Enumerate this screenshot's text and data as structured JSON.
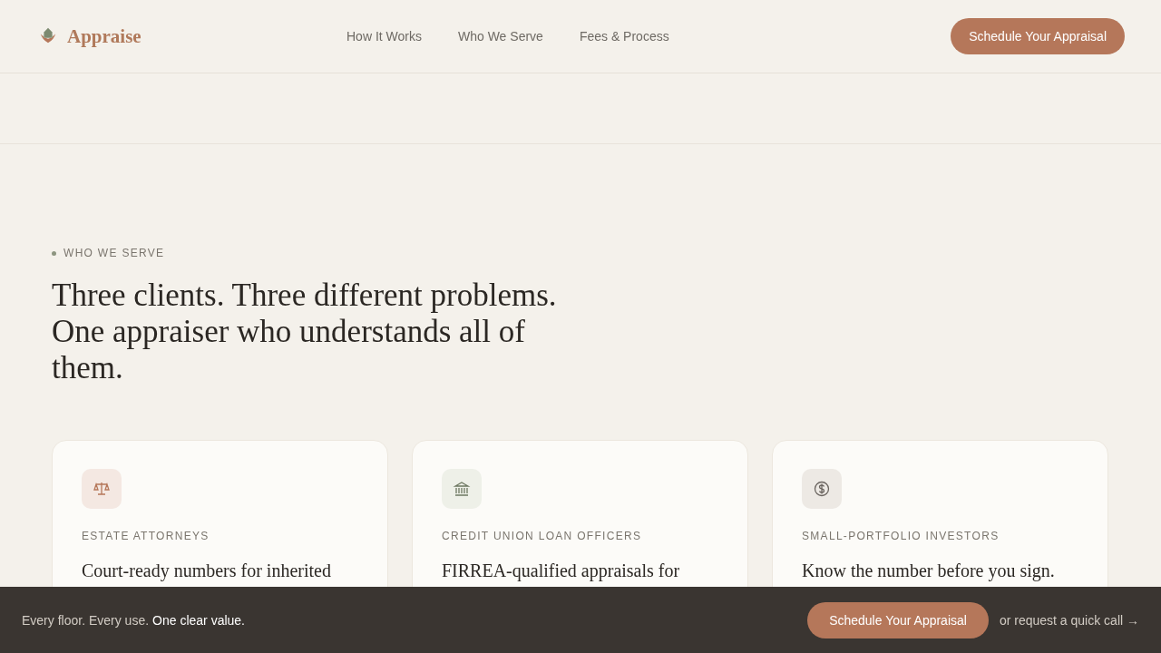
{
  "header": {
    "brand": "Appraise",
    "nav": [
      {
        "label": "How It Works"
      },
      {
        "label": "Who We Serve"
      },
      {
        "label": "Fees & Process"
      }
    ],
    "cta": "Schedule Your Appraisal"
  },
  "section": {
    "eyebrow": "WHO WE SERVE",
    "heading": "Three clients. Three different problems. One appraiser who understands all of them.",
    "cards": [
      {
        "label": "ESTATE ATTORNEYS",
        "headline": "Court-ready numbers for inherited"
      },
      {
        "label": "CREDIT UNION LOAN OFFICERS",
        "headline": "FIRREA-qualified appraisals for"
      },
      {
        "label": "SMALL-PORTFOLIO INVESTORS",
        "headline": "Know the number before you sign."
      }
    ]
  },
  "bottom_bar": {
    "lead": "Every floor. Every use.",
    "emphasis": "One clear value.",
    "cta": "Schedule Your Appraisal",
    "link": "or request a quick call →"
  }
}
